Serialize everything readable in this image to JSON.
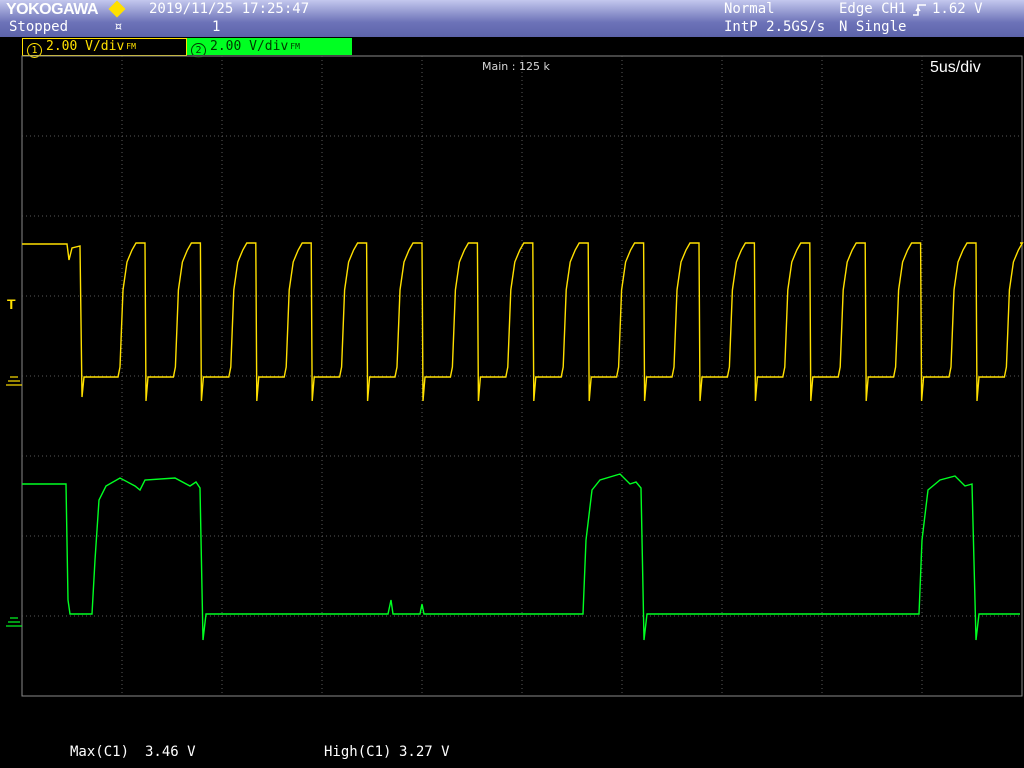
{
  "header": {
    "brand": "YOKOGAWA",
    "datetime": "2019/11/25  17:25:47",
    "status": "Stopped",
    "status_glyph": "¤",
    "acq_count": "1",
    "acq_mode": "Normal",
    "sample_rate": "IntP 2.5GS/s",
    "trigger_label": "Edge CH1",
    "trigger_level": "1.62 V",
    "trigger_mode": "N Single"
  },
  "channels": [
    {
      "num": "1",
      "scale": "2.00 V/div",
      "bw": "FM",
      "color": "#ffe000"
    },
    {
      "num": "2",
      "scale": "2.00 V/div",
      "bw": "FM",
      "color": "#00ff22"
    }
  ],
  "display": {
    "main_record": "Main : 125 k",
    "timebase": "5us/div",
    "trigger_marker": "T"
  },
  "measurements": [
    {
      "label": "Max(C1)",
      "value": "3.46 V"
    },
    {
      "label": "High(C1)",
      "value": "3.27 V"
    }
  ],
  "colors": {
    "ch1": "#ffe000",
    "ch2": "#00ff22",
    "grid": "#5a5a5a",
    "background": "#000000"
  }
}
